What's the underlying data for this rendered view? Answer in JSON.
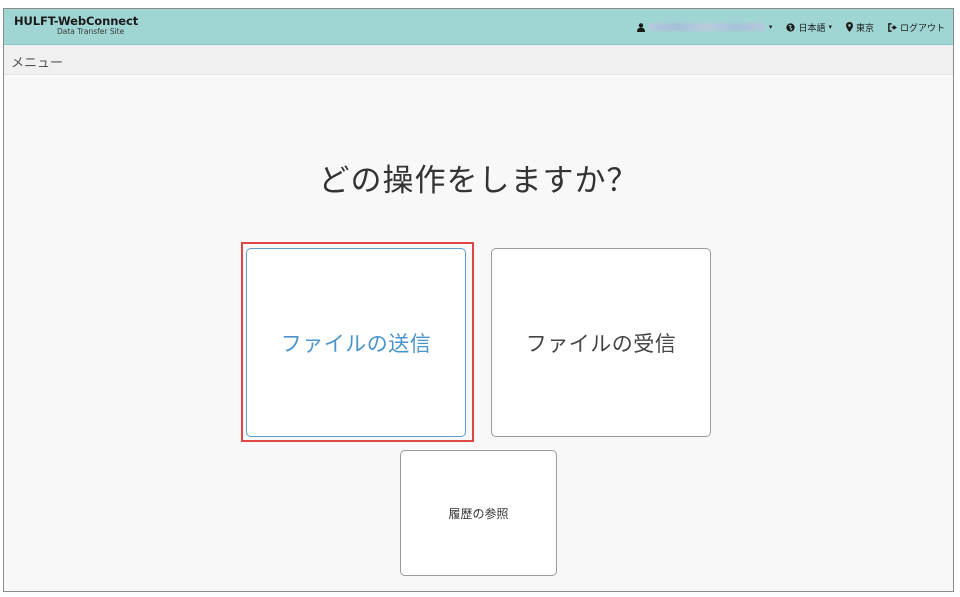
{
  "header": {
    "brand_name": "HULFT-WebConnect",
    "brand_subtitle": "Data Transfer Site",
    "user_icon": "user-icon",
    "language": "日本語",
    "location": "東京",
    "logout": "ログアウト"
  },
  "breadcrumb": "メニュー",
  "main": {
    "question": "どの操作をしますか？",
    "options": [
      {
        "label": "ファイルの送信",
        "selected": true
      },
      {
        "label": "ファイルの受信",
        "selected": false
      },
      {
        "label": "履歴の参照",
        "selected": false
      }
    ]
  },
  "colors": {
    "navbar": "#9fd6d3",
    "selected_text": "#4a94cc",
    "highlight_border": "#e04646"
  }
}
